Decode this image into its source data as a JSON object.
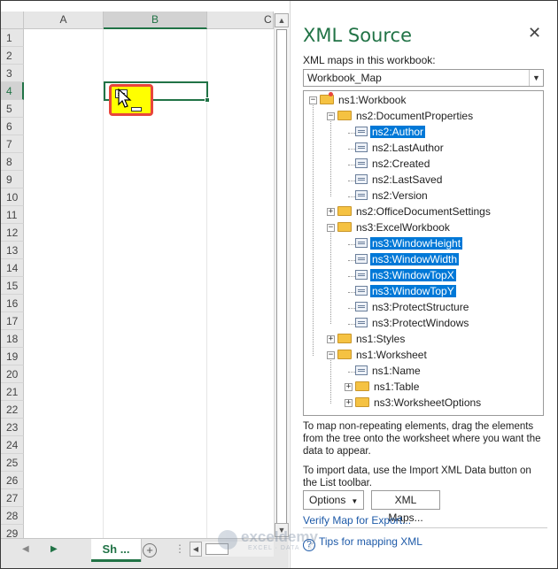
{
  "sheet": {
    "columns": [
      "A",
      "B",
      "C"
    ],
    "selected_column": "B",
    "rows": [
      "1",
      "2",
      "3",
      "4",
      "5",
      "6",
      "7",
      "8",
      "9",
      "10",
      "11",
      "12",
      "13",
      "14",
      "15",
      "16",
      "17",
      "18",
      "19",
      "20",
      "21",
      "22",
      "23",
      "24",
      "25",
      "26",
      "27",
      "28",
      "29"
    ],
    "selected_row": "4",
    "tab_label": "Sh ...",
    "add_sheet_label": "+",
    "more_label": "⋮"
  },
  "xml_source": {
    "title": "XML Source",
    "close_label": "✕",
    "maps_label": "XML maps in this workbook:",
    "selected_map": "Workbook_Map",
    "tree": [
      {
        "label": "ns1:Workbook",
        "type": "folder",
        "level": 0,
        "expander": "−",
        "highlight": false,
        "root": true
      },
      {
        "label": "ns2:DocumentProperties",
        "type": "folder",
        "level": 1,
        "expander": "−",
        "highlight": false
      },
      {
        "label": "ns2:Author",
        "type": "leaf",
        "level": 2,
        "highlight": true
      },
      {
        "label": "ns2:LastAuthor",
        "type": "leaf",
        "level": 2,
        "highlight": false
      },
      {
        "label": "ns2:Created",
        "type": "leaf",
        "level": 2,
        "highlight": false
      },
      {
        "label": "ns2:LastSaved",
        "type": "leaf",
        "level": 2,
        "highlight": false
      },
      {
        "label": "ns2:Version",
        "type": "leaf",
        "level": 2,
        "highlight": false
      },
      {
        "label": "ns2:OfficeDocumentSettings",
        "type": "folder",
        "level": 1,
        "expander": "+",
        "highlight": false
      },
      {
        "label": "ns3:ExcelWorkbook",
        "type": "folder",
        "level": 1,
        "expander": "−",
        "highlight": false
      },
      {
        "label": "ns3:WindowHeight",
        "type": "leaf",
        "level": 2,
        "highlight": true
      },
      {
        "label": "ns3:WindowWidth",
        "type": "leaf",
        "level": 2,
        "highlight": true
      },
      {
        "label": "ns3:WindowTopX",
        "type": "leaf",
        "level": 2,
        "highlight": true
      },
      {
        "label": "ns3:WindowTopY",
        "type": "leaf",
        "level": 2,
        "highlight": true
      },
      {
        "label": "ns3:ProtectStructure",
        "type": "leaf",
        "level": 2,
        "highlight": false
      },
      {
        "label": "ns3:ProtectWindows",
        "type": "leaf",
        "level": 2,
        "highlight": false
      },
      {
        "label": "ns1:Styles",
        "type": "folder",
        "level": 1,
        "expander": "+",
        "highlight": false
      },
      {
        "label": "ns1:Worksheet",
        "type": "folder",
        "level": 1,
        "expander": "−",
        "highlight": false
      },
      {
        "label": "ns1:Name",
        "type": "leaf",
        "level": 2,
        "highlight": false
      },
      {
        "label": "ns1:Table",
        "type": "folder",
        "level": 2,
        "expander": "+",
        "highlight": false
      },
      {
        "label": "ns3:WorksheetOptions",
        "type": "folder",
        "level": 2,
        "expander": "+",
        "highlight": false
      }
    ],
    "instructions_map": "To map non-repeating elements, drag the elements from the tree onto the worksheet where you want the data to appear.",
    "instructions_import": "To import data, use the Import XML Data button on the List toolbar.",
    "options_label": "Options",
    "xml_maps_label": "XML Maps...",
    "verify_link": "Verify Map for Export...",
    "tips_link": "Tips for mapping XML"
  },
  "watermark": {
    "name": "exceldemy",
    "tagline": "EXCEL · DATA · BI"
  },
  "colors": {
    "accent": "#217346",
    "selection": "#0078d7",
    "link": "#1e5aa8",
    "drop_highlight": "#ffff00",
    "drop_border": "#e8453c"
  }
}
